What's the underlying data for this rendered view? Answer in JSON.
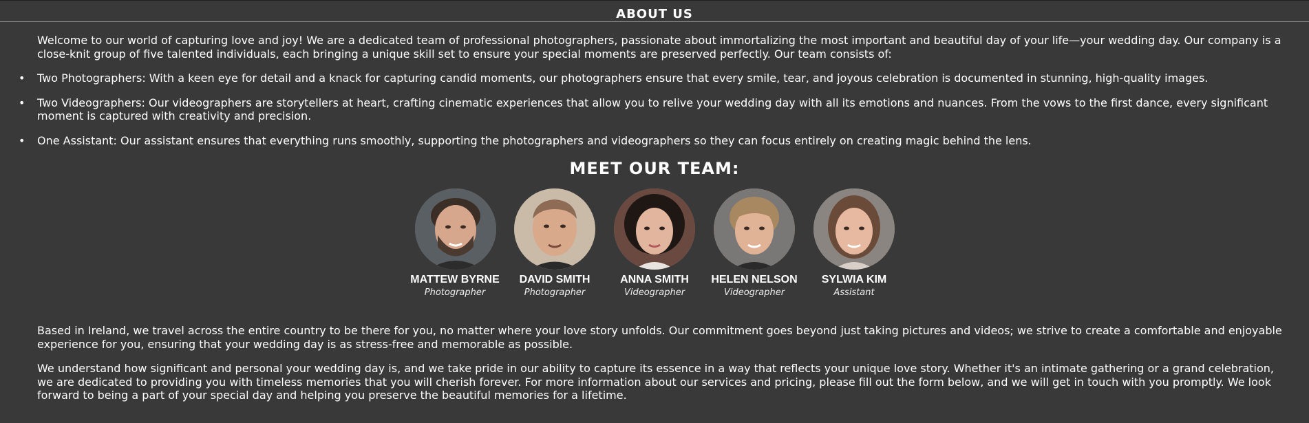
{
  "about": {
    "title": "ABOUT US",
    "intro": "Welcome to our world of capturing love and joy! We are a dedicated team of professional photographers, passionate about immortalizing the most important and beautiful day of your life—your wedding day. Our company is a close-knit group of five talented individuals, each bringing a unique skill set to ensure your special moments are preserved perfectly. Our team consists of:",
    "bullets": [
      "Two Photographers: With a keen eye for detail and a knack for capturing candid moments, our photographers ensure that every smile, tear, and joyous celebration is documented in stunning, high-quality images.",
      "Two Videographers: Our videographers are storytellers at heart, crafting cinematic experiences that allow you to relive your wedding day with all its emotions and nuances. From the vows to the first dance, every significant moment is captured with creativity and precision.",
      "One Assistant: Our assistant ensures that everything runs smoothly, supporting the photographers and videographers so they can focus entirely on creating magic behind the lens."
    ]
  },
  "team": {
    "title": "MEET OUR TEAM:",
    "members": [
      {
        "name": "MATTEW BYRNE",
        "role": "Photographer"
      },
      {
        "name": "DAVID SMITH",
        "role": "Photographer"
      },
      {
        "name": "ANNA SMITH",
        "role": "Videographer"
      },
      {
        "name": "HELEN NELSON",
        "role": "Videographer"
      },
      {
        "name": "SYLWIA KIM",
        "role": "Assistant"
      }
    ]
  },
  "outro": {
    "p1": "Based in Ireland, we travel across the entire country to be there for you, no matter where your love story unfolds. Our commitment goes beyond just taking pictures and videos; we strive to create a comfortable and enjoyable experience for you, ensuring that your wedding day is as stress-free and memorable as possible.",
    "p2": "We understand how significant and personal your wedding day is, and we take pride in our ability to capture its essence in a way that reflects your unique love story. Whether it's an intimate gathering or a grand celebration, we are dedicated to providing you with timeless memories that you will cherish forever. For more information about our services and pricing, please fill out the form below, and we will get in touch with you promptly. We look forward to being a part of your special day and helping you preserve the beautiful memories for a lifetime."
  },
  "colors": {
    "background": "#393939",
    "text": "#ffffff",
    "rule": "#8a8a8a"
  }
}
